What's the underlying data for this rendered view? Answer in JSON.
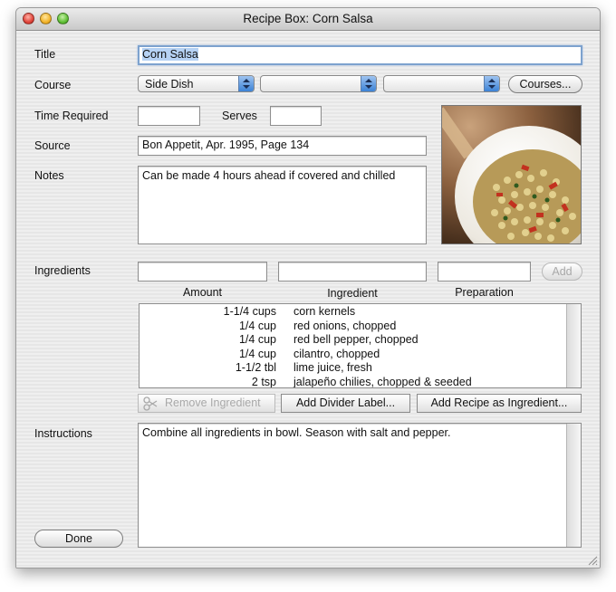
{
  "window": {
    "title": "Recipe Box: Corn Salsa"
  },
  "labels": {
    "title": "Title",
    "course": "Course",
    "time_required": "Time Required",
    "serves": "Serves",
    "source": "Source",
    "notes": "Notes",
    "ingredients": "Ingredients",
    "instructions": "Instructions"
  },
  "fields": {
    "title_value": "Corn Salsa",
    "time_required_value": "",
    "serves_value": "",
    "source_value": "Bon Appetit, Apr. 1995, Page 134",
    "notes_value": "Can be made 4 hours ahead if covered and chilled",
    "instructions_value": "Combine all ingredients in bowl.  Season with salt and pepper."
  },
  "course": {
    "popup1_value": "Side Dish",
    "popup2_value": "",
    "popup3_value": "",
    "courses_button": "Courses..."
  },
  "ingredient_entry": {
    "amount_header": "Amount",
    "ingredient_header": "Ingredient",
    "preparation_header": "Preparation",
    "add_button": "Add"
  },
  "ingredients": [
    {
      "amount": "1-1/4 cups",
      "name": "corn kernels"
    },
    {
      "amount": "1/4 cup",
      "name": "red onions, chopped"
    },
    {
      "amount": "1/4 cup",
      "name": "red bell pepper, chopped"
    },
    {
      "amount": "1/4 cup",
      "name": "cilantro, chopped"
    },
    {
      "amount": "1-1/2 tbl",
      "name": "lime juice, fresh"
    },
    {
      "amount": "2 tsp",
      "name": "jalapeño chilies, chopped & seeded"
    }
  ],
  "buttons": {
    "remove_ingredient": "Remove Ingredient",
    "add_divider_label": "Add Divider Label...",
    "add_recipe_as_ingredient": "Add Recipe as Ingredient...",
    "done": "Done"
  },
  "icons": {
    "photo": "recipe-photo",
    "scissors": "scissors-icon",
    "resize": "resize-grip-icon"
  },
  "colors": {
    "accent": "#3b82d6",
    "focus_ring": "#7da2ce",
    "selection": "#b6d2f4"
  }
}
